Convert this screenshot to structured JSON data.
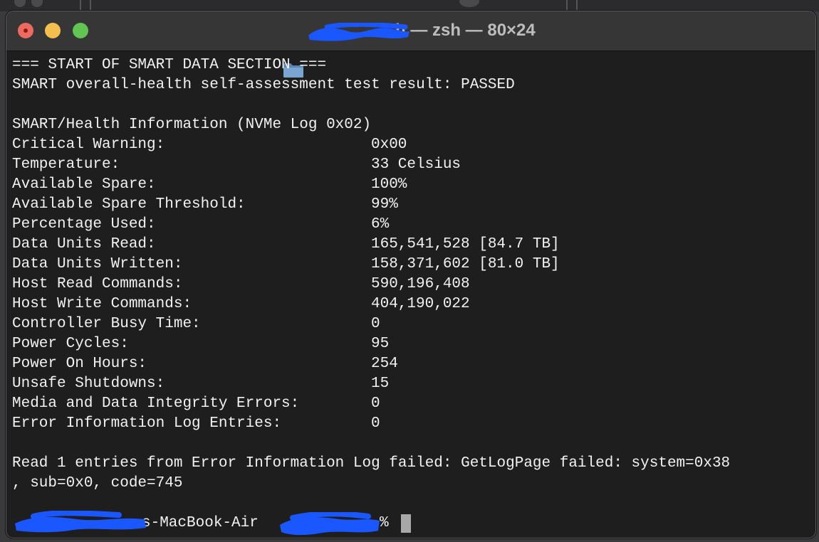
{
  "window": {
    "title": "h — zsh — 80×24",
    "colors": {
      "close": "#ed6a5e",
      "minimize": "#f5bf4f",
      "maximize": "#61c554",
      "redaction": "#1a57ff"
    }
  },
  "terminal": {
    "header_lines": [
      "=== START OF SMART DATA SECTION ===",
      "SMART overall-health self-assessment test result: PASSED",
      "",
      "SMART/Health Information (NVMe Log 0x02)"
    ],
    "rows": [
      {
        "key": "Critical Warning:",
        "value": "0x00"
      },
      {
        "key": "Temperature:",
        "value": "33 Celsius"
      },
      {
        "key": "Available Spare:",
        "value": "100%"
      },
      {
        "key": "Available Spare Threshold:",
        "value": "99%"
      },
      {
        "key": "Percentage Used:",
        "value": "6%"
      },
      {
        "key": "Data Units Read:",
        "value": "165,541,528 [84.7 TB]"
      },
      {
        "key": "Data Units Written:",
        "value": "158,371,602 [81.0 TB]"
      },
      {
        "key": "Host Read Commands:",
        "value": "590,196,408"
      },
      {
        "key": "Host Write Commands:",
        "value": "404,190,022"
      },
      {
        "key": "Controller Busy Time:",
        "value": "0"
      },
      {
        "key": "Power Cycles:",
        "value": "95"
      },
      {
        "key": "Power On Hours:",
        "value": "254"
      },
      {
        "key": "Unsafe Shutdowns:",
        "value": "15"
      },
      {
        "key": "Media and Data Integrity Errors:",
        "value": "0"
      },
      {
        "key": "Error Information Log Entries:",
        "value": "0"
      }
    ],
    "error_lines": [
      "Read 1 entries from Error Information Log failed: GetLogPage failed: system=0x38",
      ", sub=0x0, code=745"
    ],
    "prompt": {
      "host": "s-MacBook-Air",
      "symbol": "%"
    }
  }
}
